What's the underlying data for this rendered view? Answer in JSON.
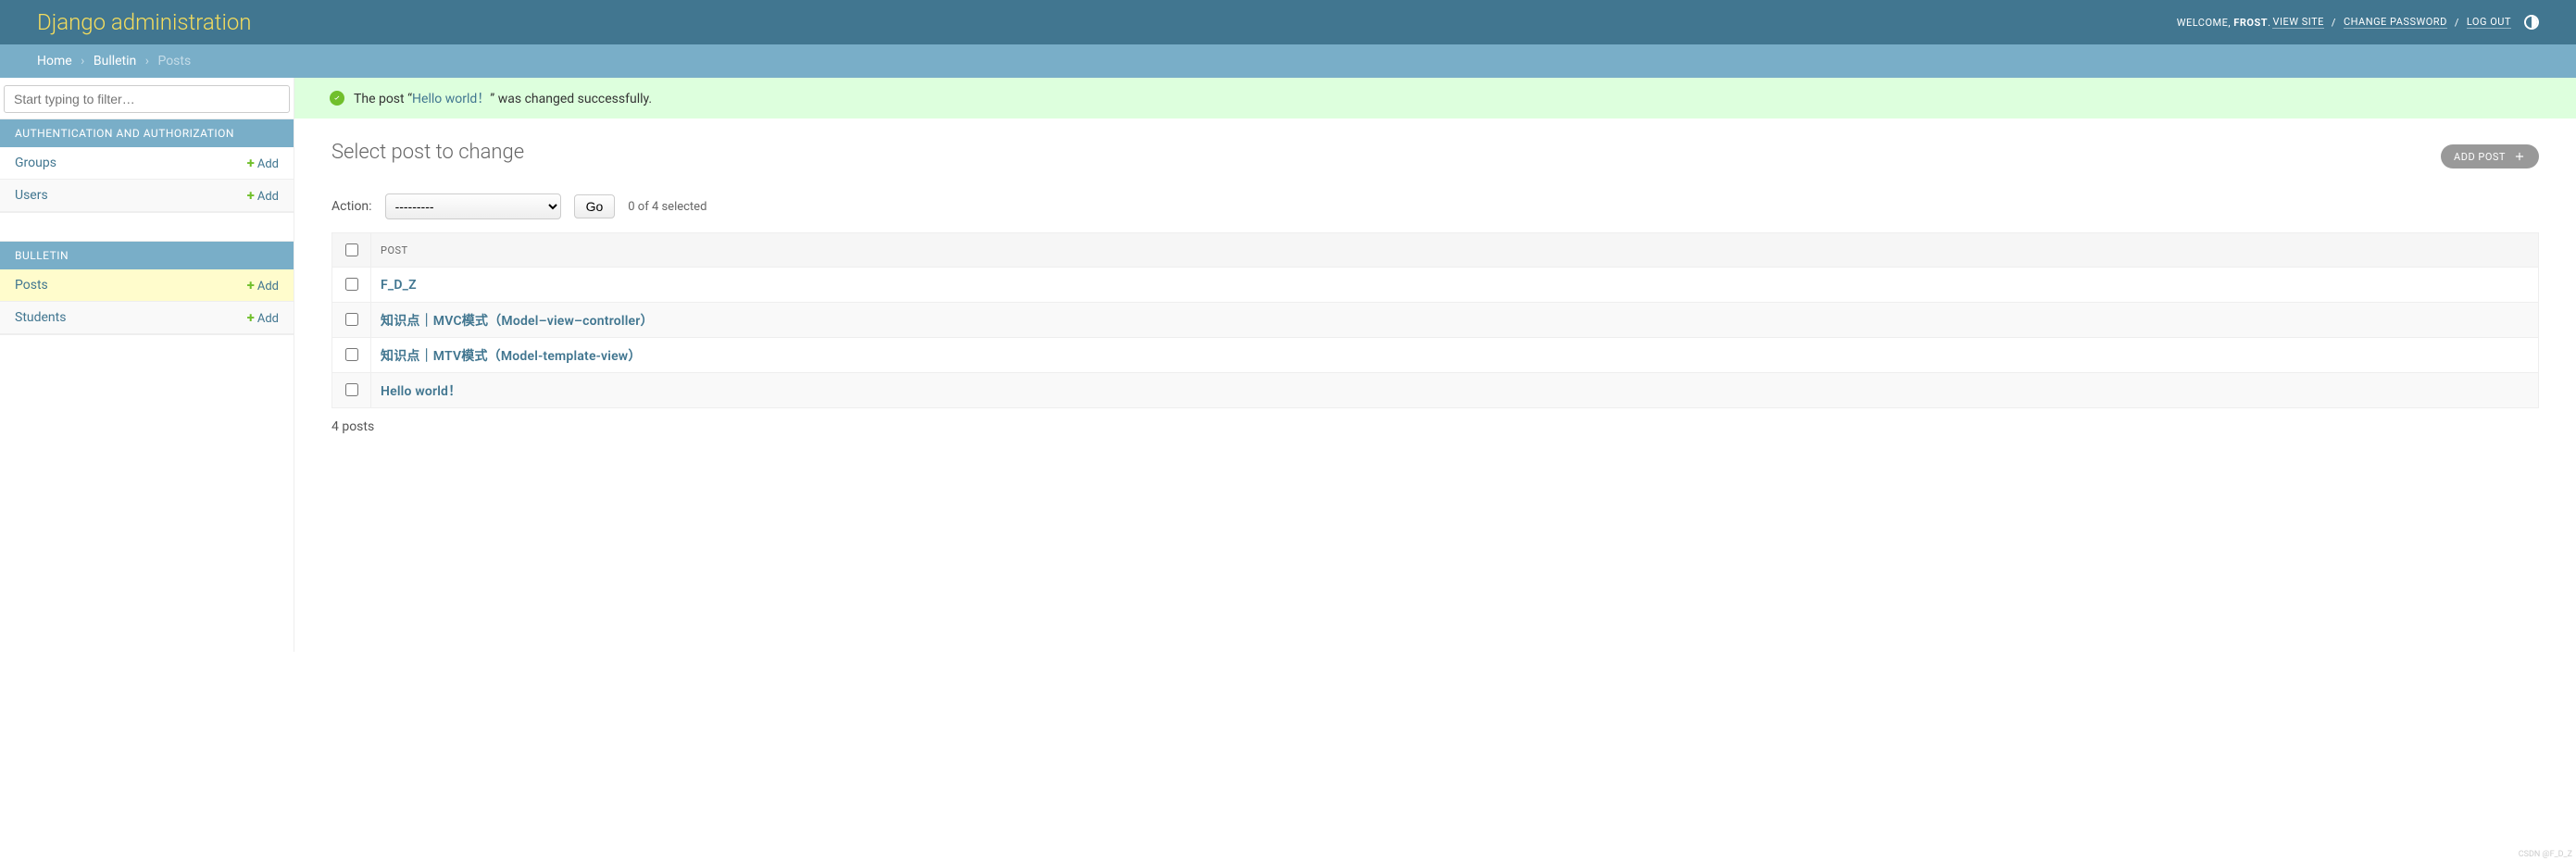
{
  "header": {
    "branding": "Django administration",
    "welcome": "WELCOME,",
    "username": "FROST",
    "view_site": "VIEW SITE",
    "change_password": "CHANGE PASSWORD",
    "log_out": "LOG OUT"
  },
  "breadcrumbs": {
    "home": "Home",
    "app": "Bulletin",
    "model": "Posts"
  },
  "sidebar": {
    "filter_placeholder": "Start typing to filter…",
    "sections": [
      {
        "caption": "AUTHENTICATION AND AUTHORIZATION",
        "rows": [
          {
            "label": "Groups",
            "add": "Add",
            "active": false
          },
          {
            "label": "Users",
            "add": "Add",
            "active": false
          }
        ]
      },
      {
        "caption": "BULLETIN",
        "rows": [
          {
            "label": "Posts",
            "add": "Add",
            "active": true
          },
          {
            "label": "Students",
            "add": "Add",
            "active": false
          }
        ]
      }
    ]
  },
  "message": {
    "prefix": "The post “",
    "link": "Hello world！",
    "suffix": "” was changed successfully."
  },
  "page": {
    "title": "Select post to change",
    "add_button": "ADD POST"
  },
  "actions": {
    "label": "Action:",
    "placeholder": "---------",
    "go": "Go",
    "counter": "0 of 4 selected"
  },
  "table": {
    "header": "POST",
    "rows": [
      {
        "title": "F_D_Z"
      },
      {
        "title": "知识点｜MVC模式（Model–view–controller）"
      },
      {
        "title": "知识点｜MTV模式（Model-template-view）"
      },
      {
        "title": "Hello world！"
      }
    ]
  },
  "paginator": "4 posts",
  "watermark": "CSDN @F_D_Z"
}
